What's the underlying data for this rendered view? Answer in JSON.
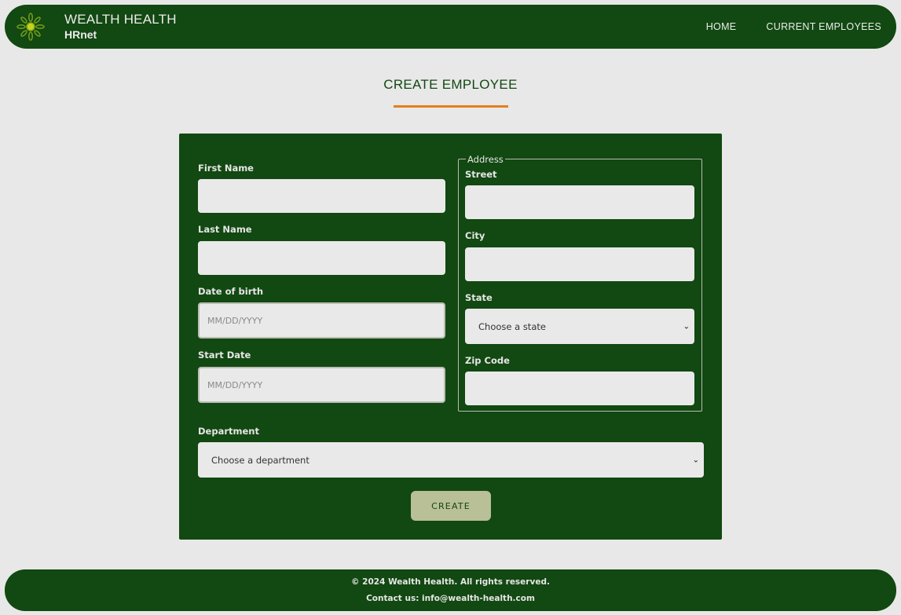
{
  "header": {
    "brand_name": "WEALTH HEALTH",
    "brand_sub": "HRnet",
    "logo_icon": "sunburst-logo-icon",
    "nav": [
      {
        "label": "HOME"
      },
      {
        "label": "CURRENT EMPLOYEES"
      }
    ]
  },
  "main": {
    "title": "CREATE EMPLOYEE"
  },
  "form": {
    "first_name": {
      "label": "First Name",
      "value": ""
    },
    "last_name": {
      "label": "Last Name",
      "value": ""
    },
    "date_of_birth": {
      "label": "Date of birth",
      "placeholder": "MM/DD/YYYY"
    },
    "start_date": {
      "label": "Start Date",
      "placeholder": "MM/DD/YYYY"
    },
    "address": {
      "legend": "Address",
      "street": {
        "label": "Street",
        "value": ""
      },
      "city": {
        "label": "City",
        "value": ""
      },
      "state": {
        "label": "State",
        "selected": "Choose a state"
      },
      "zip": {
        "label": "Zip Code",
        "value": ""
      }
    },
    "department": {
      "label": "Department",
      "selected": "Choose a department"
    },
    "submit_label": "CREATE"
  },
  "footer": {
    "copyright": "© 2024 Wealth Health. All rights reserved.",
    "contact": "Contact us: info@wealth-health.com"
  },
  "colors": {
    "brand_green": "#124811",
    "accent_orange": "#e2801d",
    "button_olive": "#b9bf96",
    "background": "#e8e8e8"
  }
}
